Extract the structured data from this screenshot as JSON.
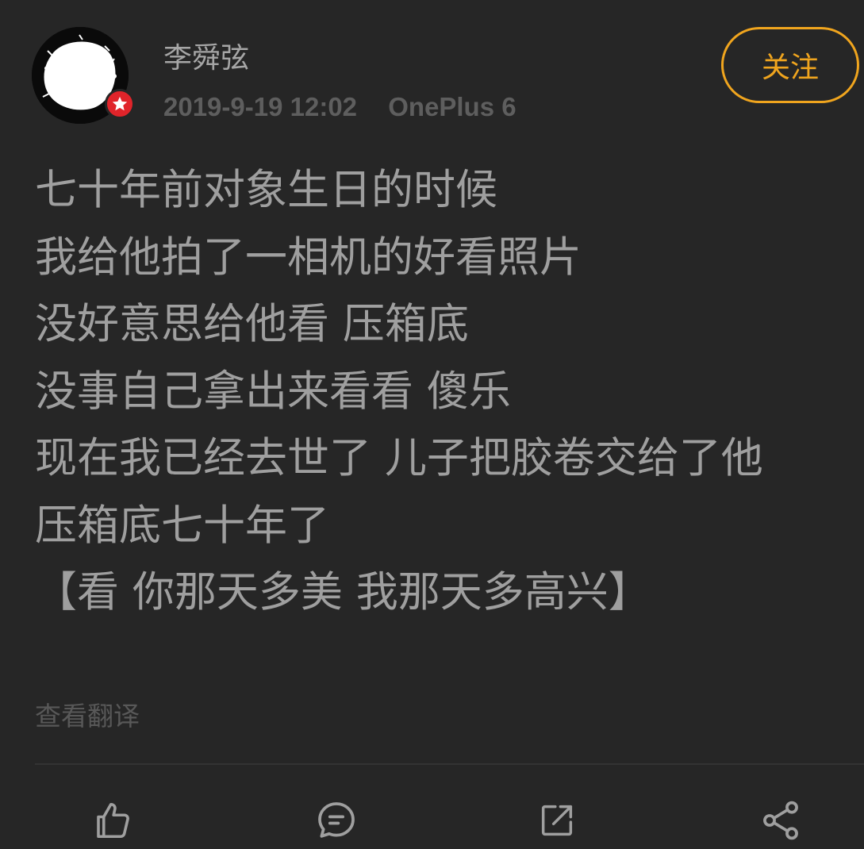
{
  "user": {
    "name": "李舜弦",
    "date": "2019-9-19 12:02",
    "device": "OnePlus 6"
  },
  "follow_label": "关注",
  "post_text": "七十年前对象生日的时候\n我给他拍了一相机的好看照片\n没好意思给他看 压箱底\n没事自己拿出来看看 傻乐\n现在我已经去世了 儿子把胶卷交给了他\n压箱底七十年了\n【看 你那天多美 我那天多高兴】",
  "translate_label": "查看翻译",
  "actions": [
    {
      "icon": "thumbs-up-icon"
    },
    {
      "icon": "comment-icon"
    },
    {
      "icon": "repost-icon"
    },
    {
      "icon": "share-icon"
    }
  ],
  "colors": {
    "background": "#262626",
    "accent": "#f0a51e",
    "badge": "#e0242a"
  }
}
